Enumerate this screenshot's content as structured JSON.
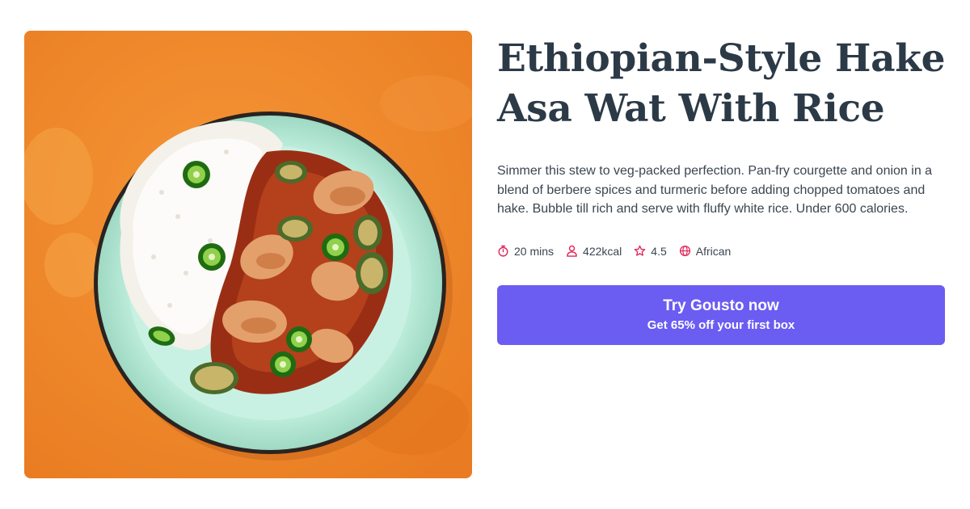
{
  "recipe": {
    "title": "Ethiopian-Style Hake Asa Wat With Rice",
    "description": "Simmer this stew to veg-packed perfection. Pan-fry courgette and onion in a blend of berbere spices and turmeric before adding chopped tomatoes and hake. Bubble till rich and serve with fluffy white rice. Under 600 calories.",
    "image_icon": "recipe-photo",
    "meta": {
      "time": "20 mins",
      "calories": "422kcal",
      "rating": "4.5",
      "cuisine": "African",
      "time_icon": "stopwatch-icon",
      "calories_icon": "person-icon",
      "rating_icon": "star-icon",
      "cuisine_icon": "globe-icon"
    }
  },
  "cta": {
    "title": "Try Gousto now",
    "subtitle": "Get 65% off your first box"
  },
  "colors": {
    "title": "#2c3a47",
    "accent_icon": "#e1255b",
    "button": "#6b5cf2",
    "photo_background": "#f08a2c"
  }
}
